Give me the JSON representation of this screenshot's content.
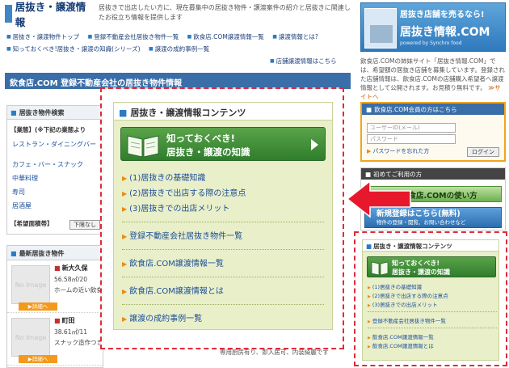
{
  "header": {
    "logo": "居抜き・譲渡情報",
    "intro": "居抜きで出店したい方に、現在募集中の居抜き物件・譲渡案件の紹介と居抜きに関連したお役立ち情報を提供します"
  },
  "nav": {
    "items": [
      "居抜き・譲渡物件トップ",
      "登録不動産会社居抜き物件一覧",
      "飲食店.COM譲渡情報一覧",
      "譲渡情報とは?",
      "知っておくべき!居抜き・譲渡の知識(シリーズ)",
      "譲渡の成約事例一覧"
    ],
    "right_link": "店舗譲渡情報はこちら"
  },
  "promo": {
    "title": "居抜き店舗を売るなら!",
    "brand": "居抜き情報.COM",
    "sub": "powered by Synchro food",
    "desc": "飲食店.COMの姉妹サイト「居抜き情報.COM」では、希望額の居抜き店舗を募集しています。登録された店舗情報は、飲食店.COMの店舗購入希望者へ譲渡情報として公開されます。お見積り無料です。",
    "more": "≫サイトへ"
  },
  "main": {
    "bar_title": "飲食店.COM 登録不動産会社の居抜き物件情報"
  },
  "search": {
    "title": "居抜き物件検索",
    "label1": "【業態】(※下記の業態より",
    "links": [
      "レストラン・ダイニングバー",
      "カフェ・バー・スナック",
      "中華料理",
      "寿司",
      "居酒屋"
    ],
    "label2": "【希望面積帯】",
    "button": "下限なし"
  },
  "new_listings": {
    "title": "最新居抜き物件",
    "items": [
      {
        "thumb": "No Image",
        "name": "新大久保",
        "size": "56.58㎡/20",
        "desc": "ホームの近い飲食",
        "button": "▶詳細へ"
      },
      {
        "thumb": "No Image",
        "name": "町田",
        "size": "38.61㎡/11",
        "desc": "スナック造作つき",
        "button": "▶詳細へ"
      }
    ]
  },
  "bottom_note": "専用厨房有り、即入居可、内装綺麗です",
  "contents_panel": {
    "title": "居抜き・譲渡情報コンテンツ",
    "banner_line1": "知っておくべき!",
    "banner_line2": "居抜き・譲渡の知識",
    "group1": [
      "(1)居抜きの基礎知識",
      "(2)居抜きで出店する際の注意点",
      "(3)居抜きでの出店メリット"
    ],
    "group2": [
      "登録不動産会社居抜き物件一覧",
      "飲食店.COM譲渡情報一覧",
      "飲食店.COM譲渡情報とは",
      "譲渡の成約事例一覧"
    ]
  },
  "member": {
    "title": "飲食店.COM会員の方はこちら",
    "user_placeholder": "ユーザーID(メール)",
    "pass_placeholder": "パスワード",
    "forgot": "パスワードを忘れた方",
    "login": "ログイン"
  },
  "first_time": {
    "title": "初めてご利用の方",
    "howto": "飲食店.COMの使い方",
    "free_main": "新規登録はこちら(無料)",
    "free_sub": "物件の登録・閲覧、お問い合わせなど"
  },
  "colors": {
    "accent_blue": "#3a6ea8",
    "panel_green": "#e9efc9",
    "callout_red": "#e02a3a"
  }
}
